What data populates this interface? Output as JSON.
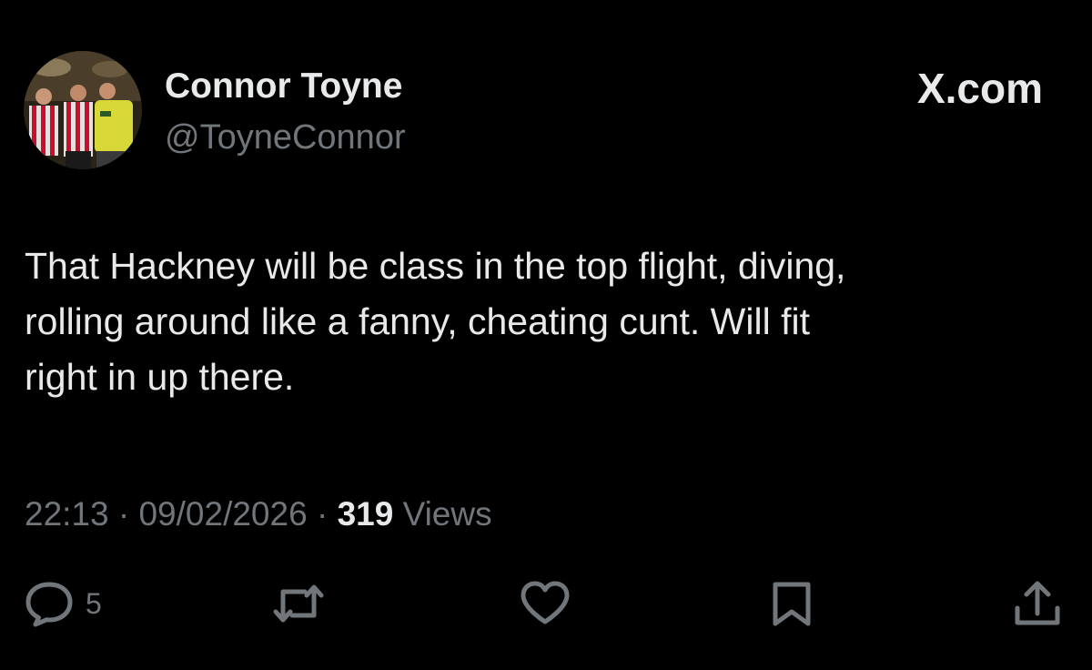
{
  "author": {
    "name": "Connor Toyne",
    "handle": "@ToyneConnor"
  },
  "brand": "X.com",
  "tweet": {
    "lines": [
      "That Hackney will be class in the top flight, diving,",
      "rolling around like a fanny, cheating cunt. Will fit",
      "right in up there."
    ]
  },
  "meta": {
    "time": "22:13",
    "date": "09/02/2026",
    "separator": " · ",
    "views_count": "319",
    "views_label": "Views"
  },
  "actions": {
    "reply_count": "5"
  },
  "colors": {
    "background": "#000000",
    "text_primary": "#e7e9ea",
    "text_secondary": "#71767b"
  },
  "icons": [
    "reply-icon",
    "repost-icon",
    "like-icon",
    "bookmark-icon",
    "share-icon"
  ]
}
